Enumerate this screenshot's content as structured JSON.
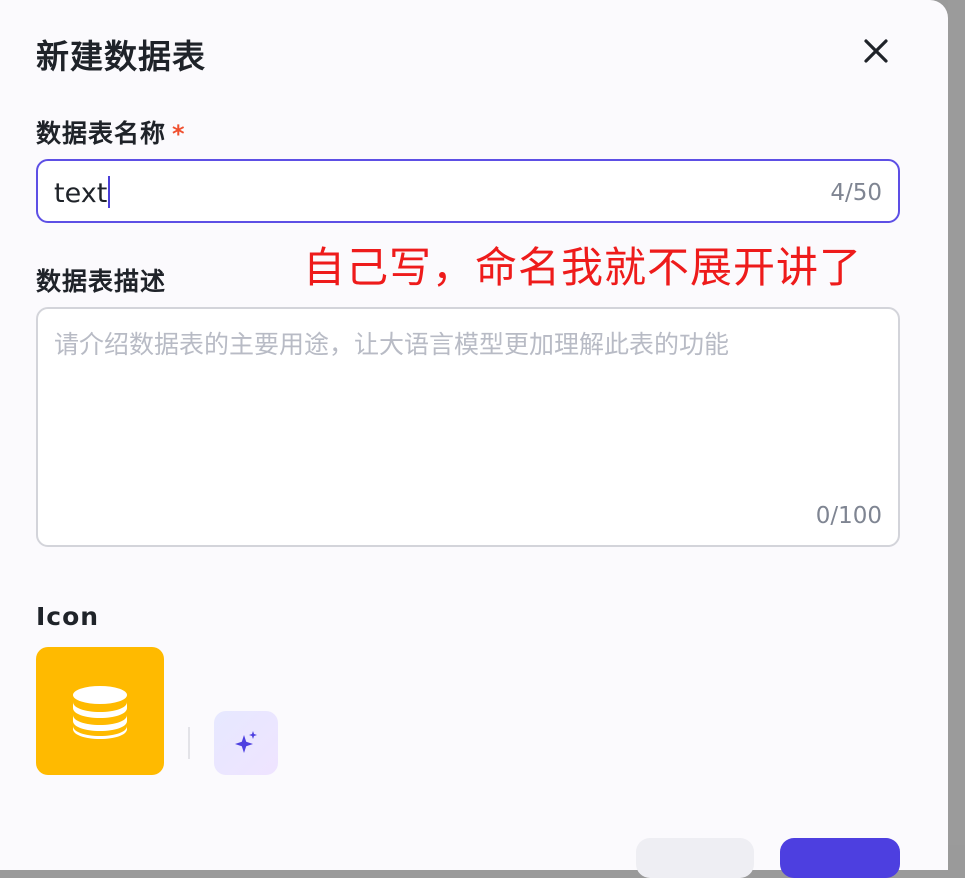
{
  "dialog": {
    "title": "新建数据表"
  },
  "name_field": {
    "label": "数据表名称",
    "required_mark": "*",
    "value": "text",
    "counter": "4/50"
  },
  "description_field": {
    "label": "数据表描述",
    "placeholder": "请介绍数据表的主要用途，让大语言模型更加理解此表的功能",
    "counter": "0/100"
  },
  "icon_section": {
    "label": "Icon",
    "selected_icon": "database-icon",
    "icon_bg_color": "#ffba00",
    "ai_button_icon": "sparkle-icon"
  },
  "annotation": {
    "text": "自己写，命名我就不展开讲了",
    "color": "#ee1b1b"
  },
  "theme": {
    "accent": "#5d4fe5"
  }
}
